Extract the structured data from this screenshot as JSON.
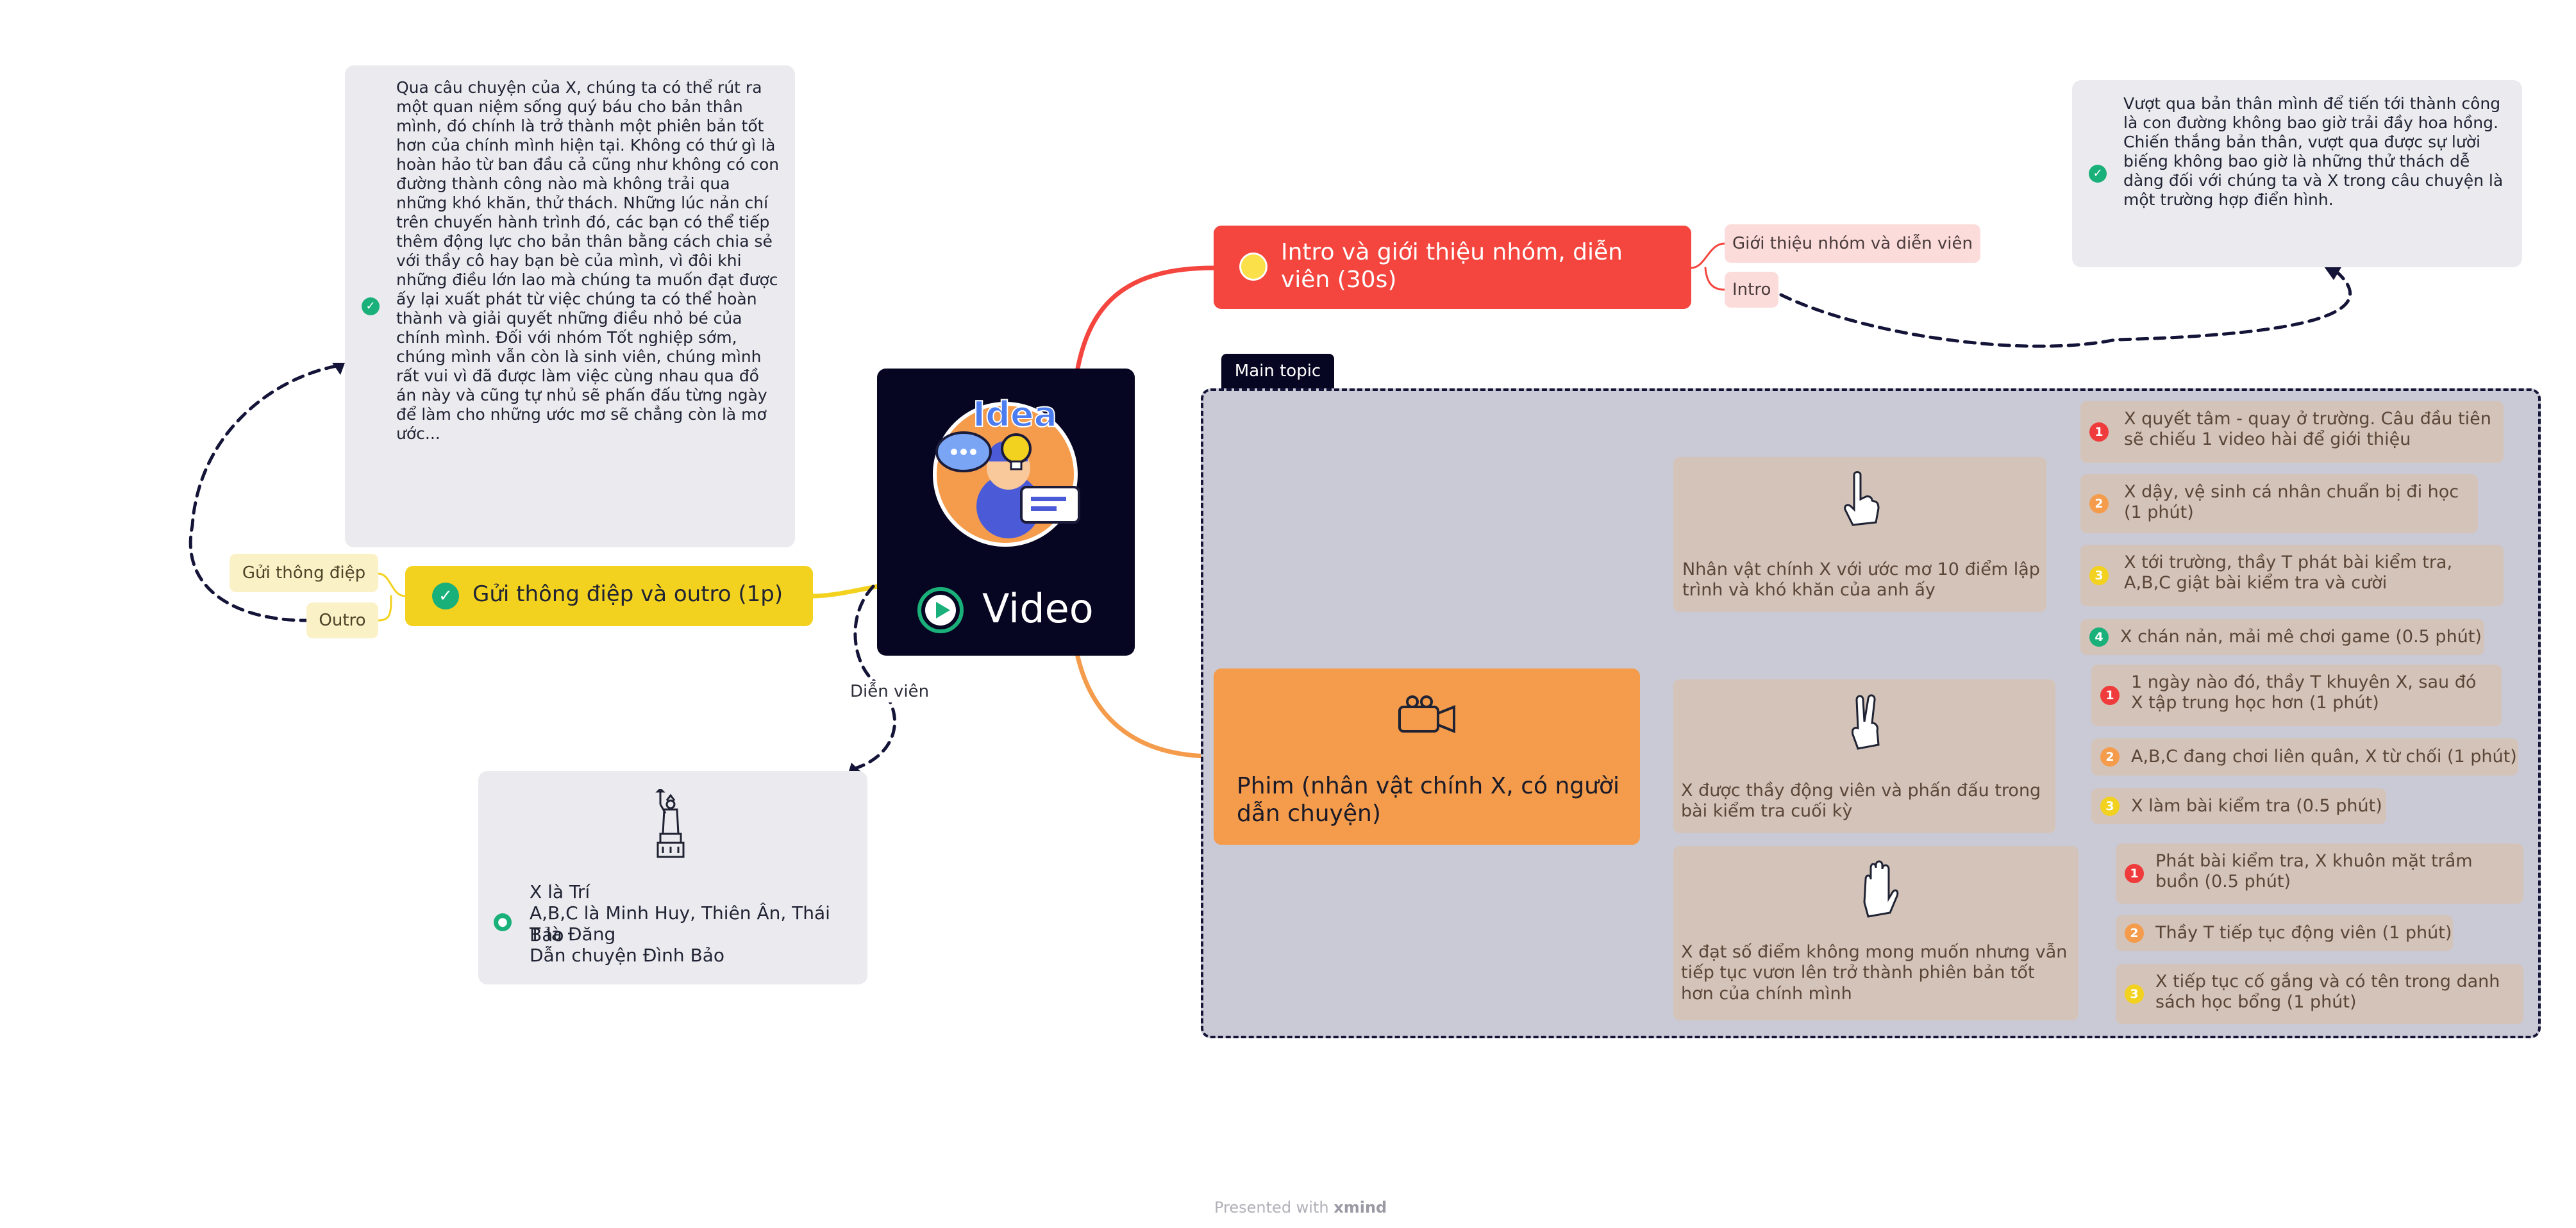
{
  "colors": {
    "central": "#060622",
    "intro_topic": "#f4453e",
    "message_topic": "#f3d21f",
    "film_topic": "#f49c4b",
    "boundary_fill": "#cacad6",
    "note_fill": "#ebeaee",
    "leaf_fill": "#d4c3b8"
  },
  "central": {
    "title": "Video",
    "logo_text": "Idea",
    "icons": [
      "idea-illustration-icon",
      "play-circle-icon"
    ]
  },
  "intro": {
    "title": "Intro và giới thiệu nhóm, diễn viên (30s)",
    "icon": "lightbulb-icon",
    "labels": [
      "Giới thiệu nhóm và diễn viên",
      "Intro"
    ],
    "note": "Vượt qua bản thân mình để tiến tới thành công là con đường không bao giờ trải đầy hoa hồng. Chiến thắng bản thân, vượt qua được sự lười biếng không bao giờ là những thử thách dễ dàng đối với chúng ta và X trong câu chuyện là một trường hợp điển hình."
  },
  "message": {
    "title": "Gửi thông điệp và outro (1p)",
    "icon": "check-circle-icon",
    "labels": [
      "Gửi thông điệp",
      "Outro"
    ],
    "note": "Qua câu chuyện của X, chúng ta có thể rút ra một quan niệm sống quý báu cho bản thân mình, đó chính là trở thành một phiên bản tốt hơn của chính mình hiện tại. Không có thứ gì là hoàn hảo từ ban đầu cả cũng như không có con đường thành công nào mà không trải qua những khó khăn, thử thách. Những lúc nản chí trên chuyến hành trình đó, các bạn có thể tiếp thêm động lực cho bản thân bằng cách chia sẻ với thầy cô hay bạn bè của mình, vì đôi khi những điều lớn lao mà chúng ta muốn đạt được ấy lại xuất phát từ việc chúng ta có thể hoàn thành và giải quyết những điều nhỏ bé của chính mình. Đối với nhóm Tốt nghiệp sớm, chúng mình vẫn còn là sinh viên, chúng mình rất vui vì đã được làm việc cùng nhau qua đồ án này và cũng tự nhủ sẽ phấn đấu từng ngày để làm cho những ước mơ sẽ chẳng còn là mơ ước..."
  },
  "cast": {
    "relation_label": "Diễn viên",
    "icon": "statue-of-liberty-icon",
    "lines": [
      "X là Trí",
      "A,B,C là Minh Huy, Thiên Ân, Thái Bảo",
      "T là Đăng",
      "Dẫn chuyện Đình Bảo"
    ]
  },
  "film": {
    "title": "Phim (nhân vật chính X, có người dẫn chuyện)",
    "icon": "video-camera-icon",
    "boundary_label": "Main topic",
    "subtopics": [
      {
        "icon": "pointing-hand-icon",
        "title": "Nhân vật chính X với ước mơ 10 điểm lập trình và khó khăn của anh ấy",
        "items": [
          {
            "num": "1",
            "text": "X quyết tâm - quay ở trường. Câu đầu tiên sẽ chiếu 1 video hài để giới thiệu"
          },
          {
            "num": "2",
            "text": "X dậy, vệ sinh cá nhân chuẩn bị đi học (1 phút)"
          },
          {
            "num": "3",
            "text": "X tới trường, thầy T phát bài kiểm tra, A,B,C giật bài kiểm tra và cười"
          },
          {
            "num": "4",
            "text": "X chán nản, mải mê chơi game (0.5 phút)"
          }
        ]
      },
      {
        "icon": "victory-hand-icon",
        "title": "X được thầy động viên và phấn đấu trong bài kiểm tra cuối kỳ",
        "items": [
          {
            "num": "1",
            "text": "1 ngày nào đó, thầy T khuyên X, sau đó X tập trung học hơn (1 phút)"
          },
          {
            "num": "2",
            "text": "A,B,C đang chơi liên quân, X từ chối (1 phút)"
          },
          {
            "num": "3",
            "text": "X làm bài kiểm tra (0.5 phút)"
          }
        ]
      },
      {
        "icon": "raised-hand-icon",
        "title": "X đạt số điểm không mong muốn nhưng vẫn tiếp tục vươn lên trở thành phiên bản tốt hơn của chính mình",
        "items": [
          {
            "num": "1",
            "text": "Phát bài kiểm tra, X khuôn mặt trầm buồn (0.5 phút)"
          },
          {
            "num": "2",
            "text": "Thầy T tiếp tục động viên (1 phút)"
          },
          {
            "num": "3",
            "text": "X tiếp tục cố gắng và có tên trong danh sách học bổng (1 phút)"
          }
        ]
      }
    ]
  },
  "footer": {
    "prefix": "Presented with",
    "brand": "xmind"
  }
}
